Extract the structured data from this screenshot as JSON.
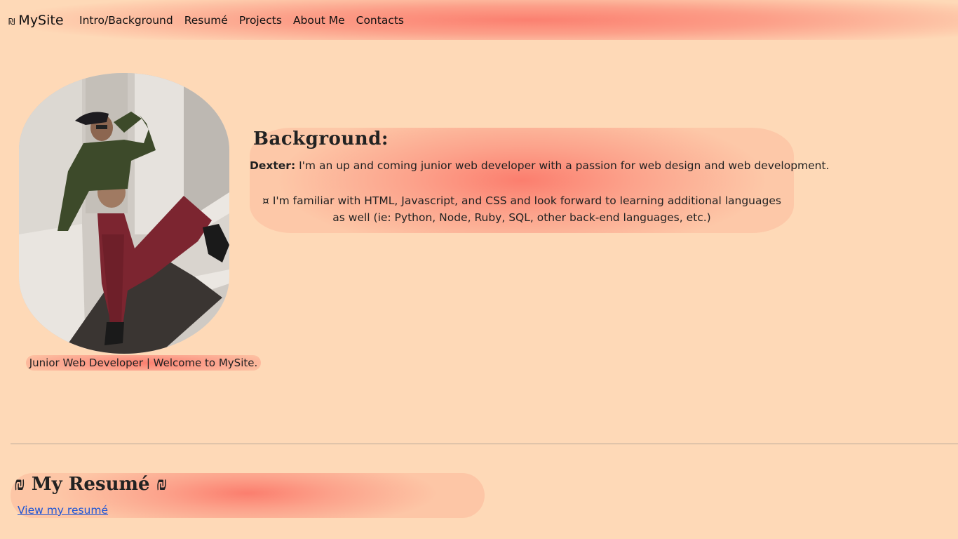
{
  "nav": {
    "brand_symbol": "₪",
    "brand_label": "MySite",
    "links": [
      {
        "label": "Intro/Background"
      },
      {
        "label": "Resumé"
      },
      {
        "label": "Projects"
      },
      {
        "label": "About Me"
      },
      {
        "label": "Contacts"
      }
    ]
  },
  "hero": {
    "photo_alt": "Portrait of a person in green cropped jacket and maroon trousers posing on concrete steps",
    "caption": "Junior Web Developer | Welcome to MySite."
  },
  "background": {
    "title": "Background:",
    "name": "Dexter:",
    "intro": " I'm an up and coming junior web developer with a passion for web design and web development.",
    "line2": "¤ I'm familiar with HTML, Javascript, and CSS and look forward to learning additional languages",
    "line3": "as well (ie: Python, Node, Ruby, SQL, other back-end languages, etc.)"
  },
  "resume": {
    "title": "₪ My Resumé ₪",
    "link_label": "View my resumé"
  },
  "colors": {
    "page_bg": "#fed9b7",
    "accent": "#fb8070",
    "link": "#1d55d6"
  }
}
